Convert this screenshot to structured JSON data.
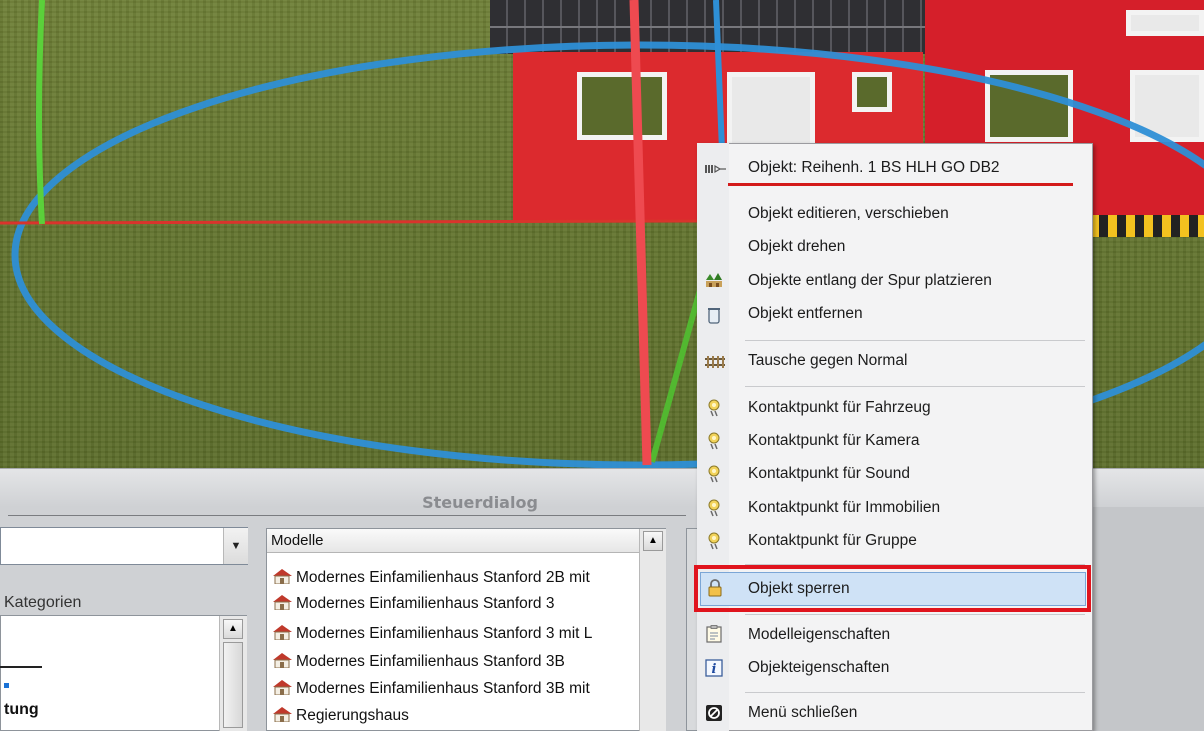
{
  "control_dialog": {
    "title": "Steuerdialog",
    "categories_label": "Kategorien",
    "categories_partial_item": "tung",
    "models_header": "Modelle",
    "models": [
      "Modernes Einfamilienhaus Stanford 2B mit",
      "Modernes Einfamilienhaus Stanford 3",
      "Modernes Einfamilienhaus Stanford 3 mit L",
      "Modernes Einfamilienhaus Stanford 3B",
      "Modernes Einfamilienhaus Stanford 3B mit",
      "Regierungshaus"
    ]
  },
  "context_menu": {
    "header": "Objekt: Reihenh. 1 BS HLH GO DB2",
    "items": [
      {
        "label": "Objekt editieren, verschieben",
        "icon": "none"
      },
      {
        "label": "Objekt drehen",
        "icon": "none"
      },
      {
        "label": "Objekte entlang der Spur platzieren",
        "icon": "trees-icon"
      },
      {
        "label": "Objekt entfernen",
        "icon": "trash-icon"
      },
      {
        "label": "Tausche gegen Normal",
        "icon": "track-icon"
      },
      {
        "label": "Kontaktpunkt für Fahrzeug",
        "icon": "contact-point-icon"
      },
      {
        "label": "Kontaktpunkt für Kamera",
        "icon": "contact-point-icon"
      },
      {
        "label": "Kontaktpunkt für Sound",
        "icon": "contact-point-icon"
      },
      {
        "label": "Kontaktpunkt für Immobilien",
        "icon": "contact-point-icon"
      },
      {
        "label": "Kontaktpunkt für Gruppe",
        "icon": "contact-point-icon"
      },
      {
        "label": "Objekt sperren",
        "icon": "lock-icon",
        "highlighted": true
      },
      {
        "label": "Modelleigenschaften",
        "icon": "clipboard-icon"
      },
      {
        "label": "Objekteigenschaften",
        "icon": "info-icon"
      },
      {
        "label": "Menü schließen",
        "icon": "close-menu-icon"
      }
    ]
  },
  "colors": {
    "house_red": "#dc2a2e",
    "highlight_border": "#e0141d",
    "header_underline": "#d31a1a",
    "hover_bg": "#cfe2f6",
    "gizmo_blue": "#3a9ad8",
    "gizmo_green": "#5bc83a",
    "gizmo_red": "#e8424a"
  }
}
